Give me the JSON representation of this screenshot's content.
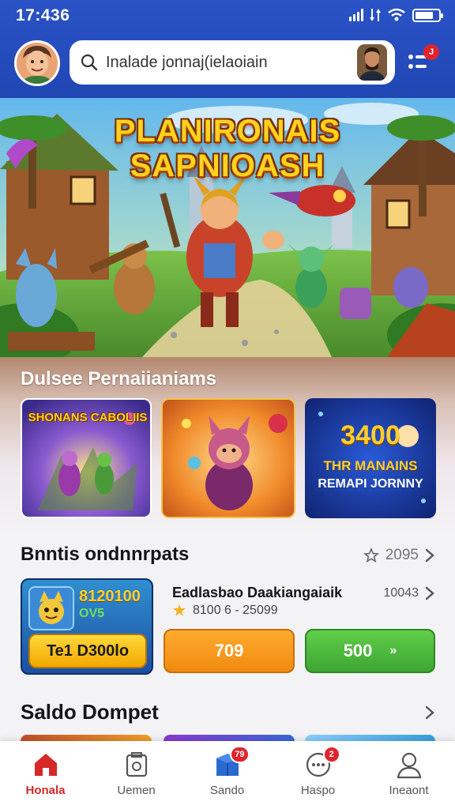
{
  "status_bar": {
    "time": "17:436"
  },
  "search": {
    "placeholder": "Inalade jonnaj(ielaoiain"
  },
  "menu": {
    "badge": "J"
  },
  "hero": {
    "title_line1": "PLANIRONAIS",
    "title_line2": "SAPNIOASH"
  },
  "section_featured": {
    "title": "Dulsee Pernaiianiams",
    "cards": [
      {
        "title": "SHONANS CABOLIIS"
      },
      {
        "title": ""
      },
      {
        "big": "3400",
        "line2": "THR MANAINS",
        "line3": "REMAPI JORNNY"
      }
    ]
  },
  "section_bonus": {
    "title": "Bnntis ondnnrpats",
    "meta": "2095",
    "card": {
      "number": "8120100",
      "sub": "OV5",
      "button": "Te1 D300lo"
    },
    "offer": {
      "title": "Eadlasbao Daakiangaiaik",
      "meta": "8100 6 - 25099",
      "right": "10043"
    },
    "price_orange": "709",
    "price_green": "500",
    "price_green_arrow": "»"
  },
  "section_saldo": {
    "title": "Saldo Dompet"
  },
  "bottom_nav": [
    {
      "label": "Honala",
      "icon": "home-icon",
      "active": true
    },
    {
      "label": "Uemen",
      "icon": "gift-icon",
      "active": false
    },
    {
      "label": "Sando",
      "icon": "wallet-icon",
      "active": false,
      "badge": "79"
    },
    {
      "label": "Haspo",
      "icon": "chat-icon",
      "active": false,
      "badge": "2"
    },
    {
      "label": "Ineaont",
      "icon": "profile-icon",
      "active": false
    }
  ],
  "colors": {
    "header": "#2147b4",
    "accent_red": "#d62828",
    "gold": "#ffd21e",
    "orange": "#f08a10",
    "green": "#3ea532"
  }
}
